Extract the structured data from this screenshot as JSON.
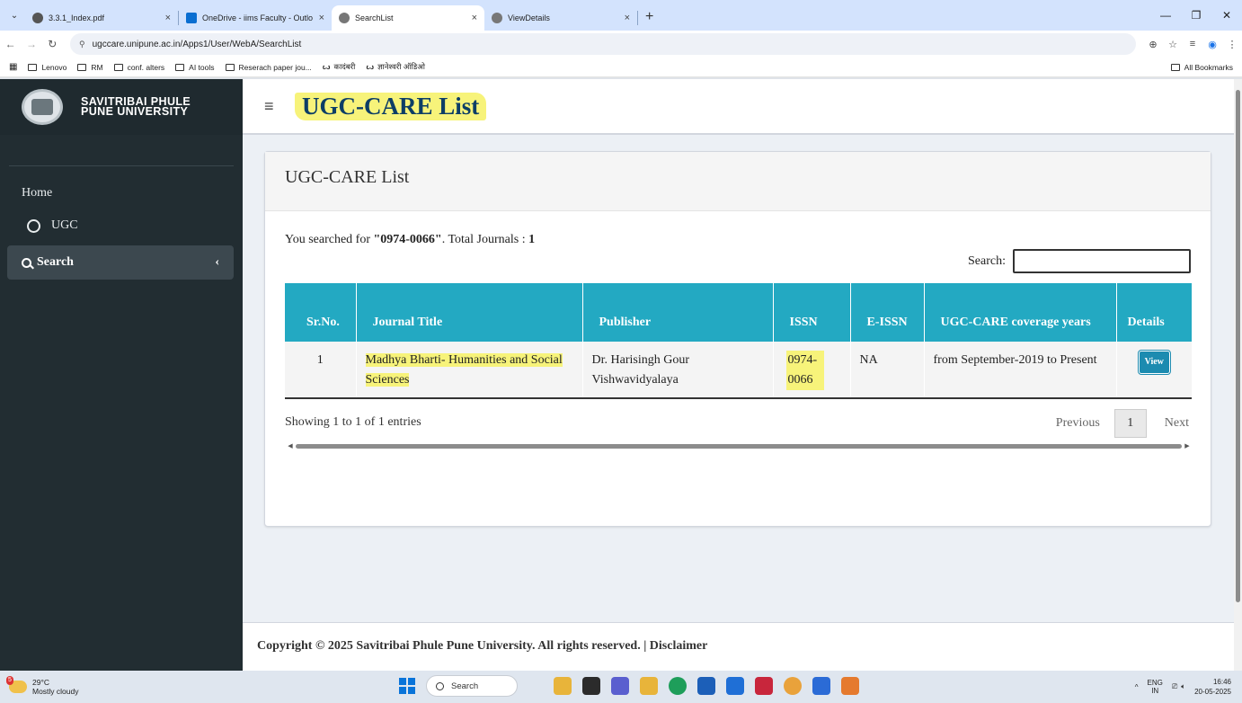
{
  "browser": {
    "tabs": [
      {
        "title": "3.3.1_Index.pdf",
        "active": false,
        "favicon_color": "#555555"
      },
      {
        "title": "OneDrive - iims Faculty - Outlo",
        "active": false,
        "favicon_color": "#0a6ed1"
      },
      {
        "title": "SearchList",
        "active": true,
        "favicon_color": "#777777"
      },
      {
        "title": "ViewDetails",
        "active": false,
        "favicon_color": "#777777"
      }
    ],
    "tab_close_glyph": "×",
    "new_tab_glyph": "+",
    "tab_menu_glyph": "⌄",
    "url": "ugccare.unipune.ac.in/Apps1/User/WebA/SearchList",
    "bookmarks": [
      "Lenovo",
      "RM",
      "conf. alters",
      "AI tools",
      "Reserach paper jou...",
      "कादंबरी",
      "ज्ञानेश्वरी ऑडिओ"
    ],
    "all_bookmarks": "All Bookmarks"
  },
  "sidebar": {
    "brand_line1": "SAVITRIBAI PHULE",
    "brand_line2": "PUNE UNIVERSITY",
    "home": "Home",
    "ugc": "UGC",
    "search": "Search",
    "chevron": "‹"
  },
  "header": {
    "menu_glyph": "≡",
    "title": "UGC-CARE List"
  },
  "box": {
    "title": "UGC-CARE List",
    "summary_prefix": "You searched for ",
    "query": "\"0974-0066\"",
    "summary_mid": ". Total Journals : ",
    "total": "1",
    "search_label": "Search:",
    "search_value": ""
  },
  "table": {
    "headers": [
      "Sr.No.",
      "Journal Title",
      "Publisher",
      "ISSN",
      "E-ISSN",
      "UGC-CARE coverage years",
      "Details"
    ],
    "rows": [
      {
        "sr": "1",
        "title": "Madhya Bharti- Humanities and Social Sciences",
        "publisher": "Dr. Harisingh Gour Vishwavidyalaya",
        "issn": "0974-0066",
        "eissn": "NA",
        "coverage": "from September-2019 to Present",
        "details": "View"
      }
    ]
  },
  "pagination": {
    "info": "Showing 1 to 1 of 1 entries",
    "previous": "Previous",
    "page": "1",
    "next": "Next"
  },
  "footer": {
    "text": "Copyright © 2025 Savitribai Phule Pune University. All rights reserved. | Disclaimer"
  },
  "taskbar": {
    "weather_badge": "5",
    "temperature": "29°C",
    "condition": "Mostly cloudy",
    "search_placeholder": "Search",
    "lang1": "ENG",
    "lang2": "IN",
    "time": "16:46",
    "date": "20-05-2025",
    "app_colors": [
      "#e8b43a",
      "#2b2b2b",
      "#5a5fcf",
      "#e8b43a",
      "#1e9e5a",
      "#1c5fb8",
      "#1f6fd6",
      "#c8263c",
      "#e9a23b",
      "#2b6bd6",
      "#e57a2e"
    ]
  }
}
